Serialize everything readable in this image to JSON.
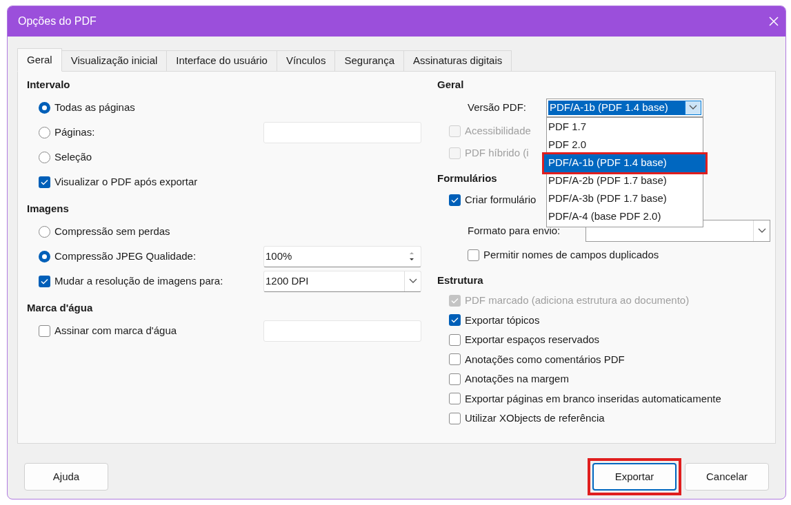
{
  "window": {
    "title": "Opções do PDF"
  },
  "tabs": [
    {
      "label": "Geral",
      "selected": true
    },
    {
      "label": "Visualização inicial",
      "selected": false
    },
    {
      "label": "Interface do usuário",
      "selected": false
    },
    {
      "label": "Vínculos",
      "selected": false
    },
    {
      "label": "Segurança",
      "selected": false
    },
    {
      "label": "Assinaturas digitais",
      "selected": false
    }
  ],
  "left_sections": [
    {
      "title": "Intervalo",
      "items": [
        {
          "kind": "radio",
          "label": "Todas as páginas",
          "selected": true
        },
        {
          "kind": "radio",
          "label": "Páginas:",
          "selected": false,
          "input": {
            "kind": "text"
          }
        },
        {
          "kind": "radio",
          "label": "Seleção",
          "selected": false
        },
        {
          "kind": "checkbox",
          "label": "Visualizar o PDF após exportar",
          "checked": true,
          "disabled": false
        }
      ]
    },
    {
      "title": "Imagens",
      "items": [
        {
          "kind": "radio",
          "label": "Compressão sem perdas",
          "selected": false
        },
        {
          "kind": "radio",
          "label": "Compressão JPEG  Qualidade:",
          "selected": true,
          "input": {
            "kind": "spin",
            "value": "100%"
          }
        },
        {
          "kind": "checkbox",
          "label": "Mudar a resolução de imagens para:",
          "checked": true,
          "disabled": false,
          "input": {
            "kind": "combo",
            "value": "1200 DPI"
          }
        }
      ]
    },
    {
      "title": "Marca d'água",
      "items": [
        {
          "kind": "checkbox",
          "label": "Assinar com marca d'água",
          "checked": false,
          "disabled": false,
          "input": {
            "kind": "text"
          }
        }
      ]
    }
  ],
  "right_sections": [
    {
      "title": "Geral",
      "items": [
        {
          "kind": "version",
          "label": "Versão PDF:",
          "value": "PDF/A-1b (PDF 1.4 base)",
          "options": [
            {
              "label": "PDF 1.7",
              "selected": false,
              "highlighted": false
            },
            {
              "label": "PDF 2.0",
              "selected": false,
              "highlighted": false
            },
            {
              "label": "PDF/A-1b (PDF 1.4 base)",
              "selected": true,
              "highlighted": true
            },
            {
              "label": "PDF/A-2b (PDF 1.7 base)",
              "selected": false,
              "highlighted": false
            },
            {
              "label": "PDF/A-3b (PDF 1.7 base)",
              "selected": false,
              "highlighted": false
            },
            {
              "label": "PDF/A-4 (base PDF 2.0)",
              "selected": false,
              "highlighted": false
            }
          ]
        },
        {
          "kind": "checkbox",
          "label": "Acessibilidade",
          "checked": false,
          "disabled": true
        },
        {
          "kind": "checkbox",
          "label": "PDF híbrido (i",
          "checked": false,
          "disabled": true
        }
      ]
    },
    {
      "title": "Formulários",
      "items": [
        {
          "kind": "checkbox",
          "label": "Criar formulário",
          "checked": true,
          "disabled": false
        },
        {
          "kind": "format",
          "label": "Formato para envio:"
        },
        {
          "kind": "sub_checkbox",
          "label": "Permitir nomes de campos duplicados",
          "checked": false,
          "disabled": false
        }
      ]
    },
    {
      "title": "Estrutura",
      "items": [
        {
          "kind": "checkbox",
          "label": "PDF marcado (adiciona estrutura ao documento)",
          "checked": true,
          "disabled": true
        },
        {
          "kind": "checkbox",
          "label": "Exportar tópicos",
          "checked": true,
          "disabled": false
        },
        {
          "kind": "checkbox",
          "label": "Exportar espaços reservados",
          "checked": false,
          "disabled": false
        },
        {
          "kind": "checkbox",
          "label": "Anotações como comentários PDF",
          "checked": false,
          "disabled": false
        },
        {
          "kind": "checkbox",
          "label": "Anotações na margem",
          "checked": false,
          "disabled": false
        },
        {
          "kind": "checkbox",
          "label": "Exportar páginas em branco inseridas automaticamente",
          "checked": false,
          "disabled": false
        },
        {
          "kind": "checkbox",
          "label": "Utilizar XObjects de referência",
          "checked": false,
          "disabled": false
        }
      ]
    }
  ],
  "buttons": [
    {
      "label": "Ajuda",
      "kind": "help",
      "highlighted": false
    },
    {
      "label": "Exportar",
      "kind": "default",
      "highlighted": true
    },
    {
      "label": "Cancelar",
      "kind": "normal",
      "highlighted": false
    }
  ]
}
